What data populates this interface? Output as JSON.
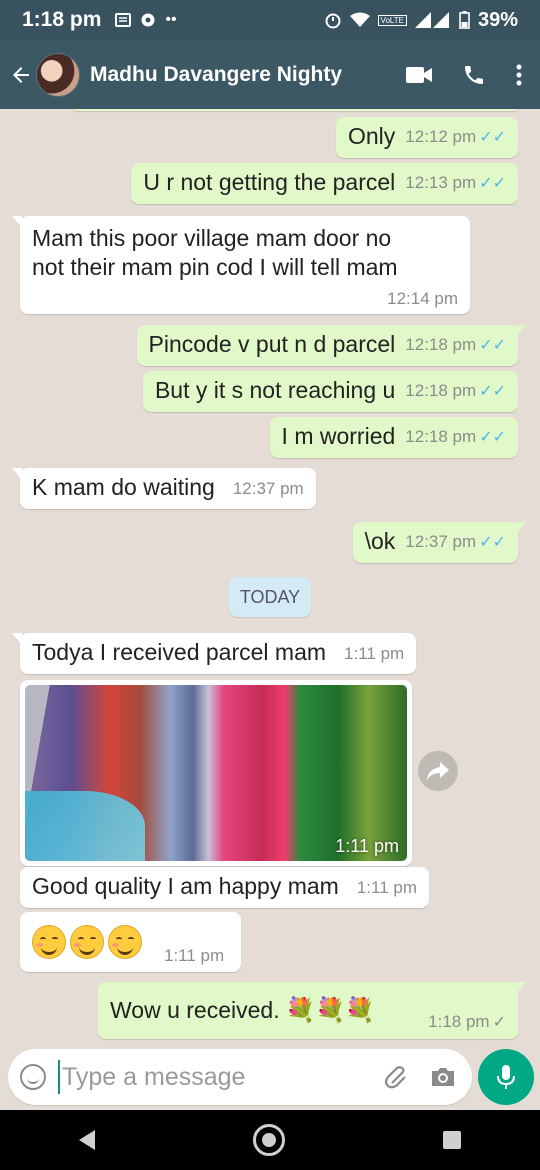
{
  "status_bar": {
    "time": "1:18 pm",
    "volte": "VoLTE",
    "battery": "39%"
  },
  "header": {
    "contact_name": "Madhu Davangere Nighty"
  },
  "messages": [
    {
      "text": "Only",
      "time": "12:12 pm",
      "direction": "out",
      "status": "read"
    },
    {
      "text": "U r not getting the parcel",
      "time": "12:13 pm",
      "direction": "out",
      "status": "read"
    },
    {
      "line1": "Mam this poor village mam door no",
      "line2": "not their mam pin cod I will tell mam",
      "time": "12:14 pm",
      "direction": "in"
    },
    {
      "text": "Pincode v put n d parcel",
      "time": "12:18 pm",
      "direction": "out",
      "status": "read"
    },
    {
      "text": "But y it s not reaching u",
      "time": "12:18 pm",
      "direction": "out",
      "status": "read"
    },
    {
      "text": "I m worried",
      "time": "12:18 pm",
      "direction": "out",
      "status": "read"
    },
    {
      "text": "K mam do  waiting",
      "time": "12:37 pm",
      "direction": "in"
    },
    {
      "text": "\\ok",
      "time": "12:37 pm",
      "direction": "out",
      "status": "read"
    },
    {
      "text": "Todya I received parcel mam",
      "time": "1:11 pm",
      "direction": "in"
    },
    {
      "photo_time": "1:11 pm",
      "direction": "in",
      "type": "image"
    },
    {
      "text": "Good quality I am happy mam",
      "time": "1:11 pm",
      "direction": "in"
    },
    {
      "emoji_count": 3,
      "time": "1:11 pm",
      "direction": "in",
      "type": "emoji"
    },
    {
      "text": "Wow u received.",
      "flowers": "💐💐💐",
      "time": "1:18 pm",
      "direction": "out",
      "status": "sent"
    }
  ],
  "date_divider": "TODAY",
  "composer": {
    "placeholder": "Type a message"
  },
  "icons": {
    "tick_read": "✓✓",
    "tick_sent": "✓"
  },
  "colors": {
    "header": "#3d5865",
    "outgoing_bubble": "#e1f8c8",
    "incoming_bubble": "#ffffff",
    "read_ticks": "#4fb6ec",
    "mic_button": "#00a884"
  }
}
